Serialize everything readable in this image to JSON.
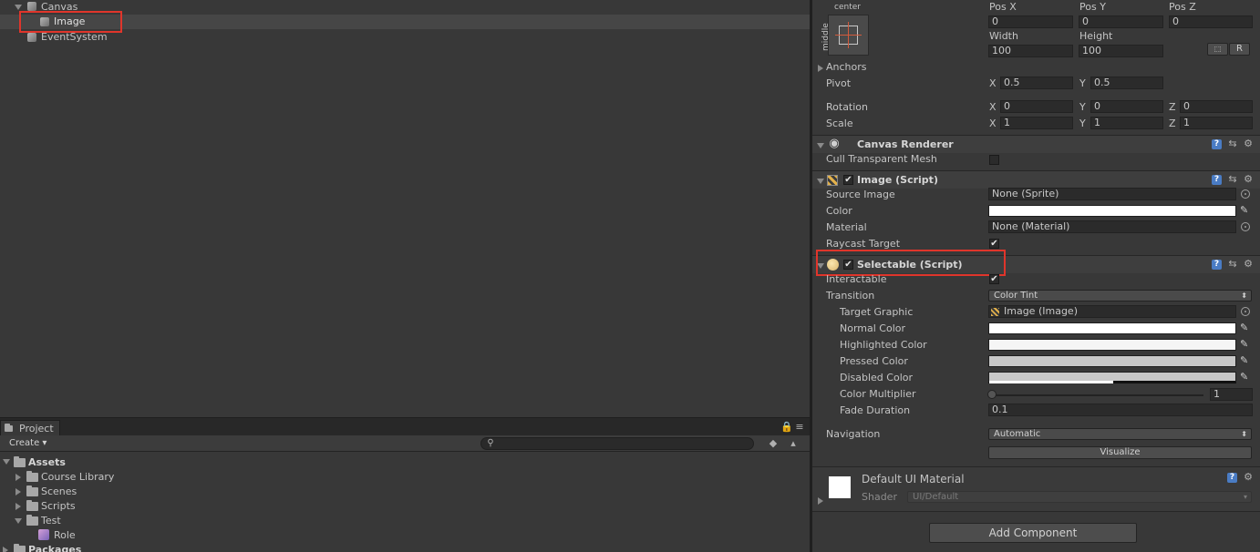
{
  "hierarchy": {
    "items": [
      {
        "label": "Canvas"
      },
      {
        "label": "Image"
      },
      {
        "label": "EventSystem"
      }
    ]
  },
  "project": {
    "tab_label": "Project",
    "create_label": "Create",
    "tree": [
      {
        "label": "Assets"
      },
      {
        "label": "Course Library"
      },
      {
        "label": "Scenes"
      },
      {
        "label": "Scripts"
      },
      {
        "label": "Test"
      },
      {
        "label": "Role"
      },
      {
        "label": "Packages"
      }
    ]
  },
  "rect_transform": {
    "anchor_h": "center",
    "anchor_v": "middle",
    "pos_x_label": "Pos X",
    "pos_y_label": "Pos Y",
    "pos_z_label": "Pos Z",
    "pos_x": "0",
    "pos_y": "0",
    "pos_z": "0",
    "width_label": "Width",
    "height_label": "Height",
    "width": "100",
    "height": "100",
    "r_button": "R",
    "anchors_label": "Anchors",
    "pivot_label": "Pivot",
    "pivot_x": "0.5",
    "pivot_y": "0.5",
    "rotation_label": "Rotation",
    "rot_x": "0",
    "rot_y": "0",
    "rot_z": "0",
    "scale_label": "Scale",
    "scale_x": "1",
    "scale_y": "1",
    "scale_z": "1",
    "axis_x": "X",
    "axis_y": "Y",
    "axis_z": "Z"
  },
  "canvas_renderer": {
    "title": "Canvas Renderer",
    "cull_label": "Cull Transparent Mesh"
  },
  "image_script": {
    "title": "Image (Script)",
    "source_label": "Source Image",
    "source_value": "None (Sprite)",
    "color_label": "Color",
    "material_label": "Material",
    "material_value": "None (Material)",
    "raycast_label": "Raycast Target"
  },
  "selectable": {
    "title": "Selectable (Script)",
    "interactable_label": "Interactable",
    "transition_label": "Transition",
    "transition_value": "Color Tint",
    "target_label": "Target Graphic",
    "target_value": "Image (Image)",
    "normal_label": "Normal Color",
    "highlighted_label": "Highlighted Color",
    "pressed_label": "Pressed Color",
    "disabled_label": "Disabled Color",
    "multiplier_label": "Color Multiplier",
    "multiplier_value": "1",
    "fade_label": "Fade Duration",
    "fade_value": "0.1",
    "navigation_label": "Navigation",
    "navigation_value": "Automatic",
    "visualize_label": "Visualize",
    "colors": {
      "normal": "#ffffff",
      "highlighted": "#f5f5f5",
      "pressed": "#c8c8c8",
      "disabled": "#c8c8c8"
    }
  },
  "material": {
    "title": "Default UI Material",
    "shader_label": "Shader",
    "shader_value": "UI/Default"
  },
  "add_component_label": "Add Component",
  "accent": {
    "highlight_box": "#e0352b",
    "help_icon": "#4a7cc4"
  }
}
